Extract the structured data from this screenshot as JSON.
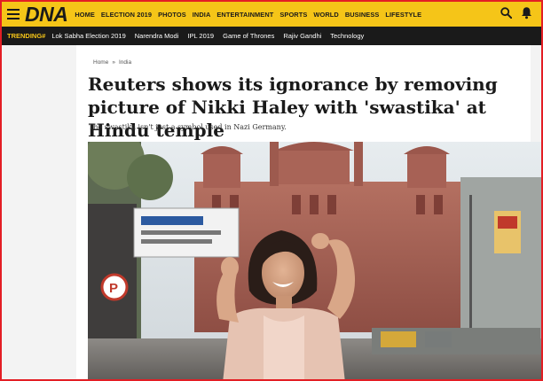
{
  "header": {
    "logo": "DNA",
    "nav": [
      "HOME",
      "ELECTION 2019",
      "PHOTOS",
      "INDIA",
      "ENTERTAINMENT",
      "SPORTS",
      "WORLD",
      "BUSINESS",
      "LIFESTYLE"
    ]
  },
  "trending": {
    "label": "TRENDING#",
    "items": [
      "Lok Sabha Election 2019",
      "Narendra Modi",
      "IPL 2019",
      "Game of Thrones",
      "Rajiv Gandhi",
      "Technology"
    ]
  },
  "breadcrumb": [
    "Home",
    "India"
  ],
  "article": {
    "headline": "Reuters shows its ignorance by removing picture of Nikki Haley with 'swastika' at Hindu temple",
    "subheadline": "The swastika isn't just a symbol used in Nazi Germany."
  },
  "colors": {
    "brand_yellow": "#f5c518",
    "trending_bar": "#1a1a1a",
    "frame_red": "#e31e24"
  }
}
